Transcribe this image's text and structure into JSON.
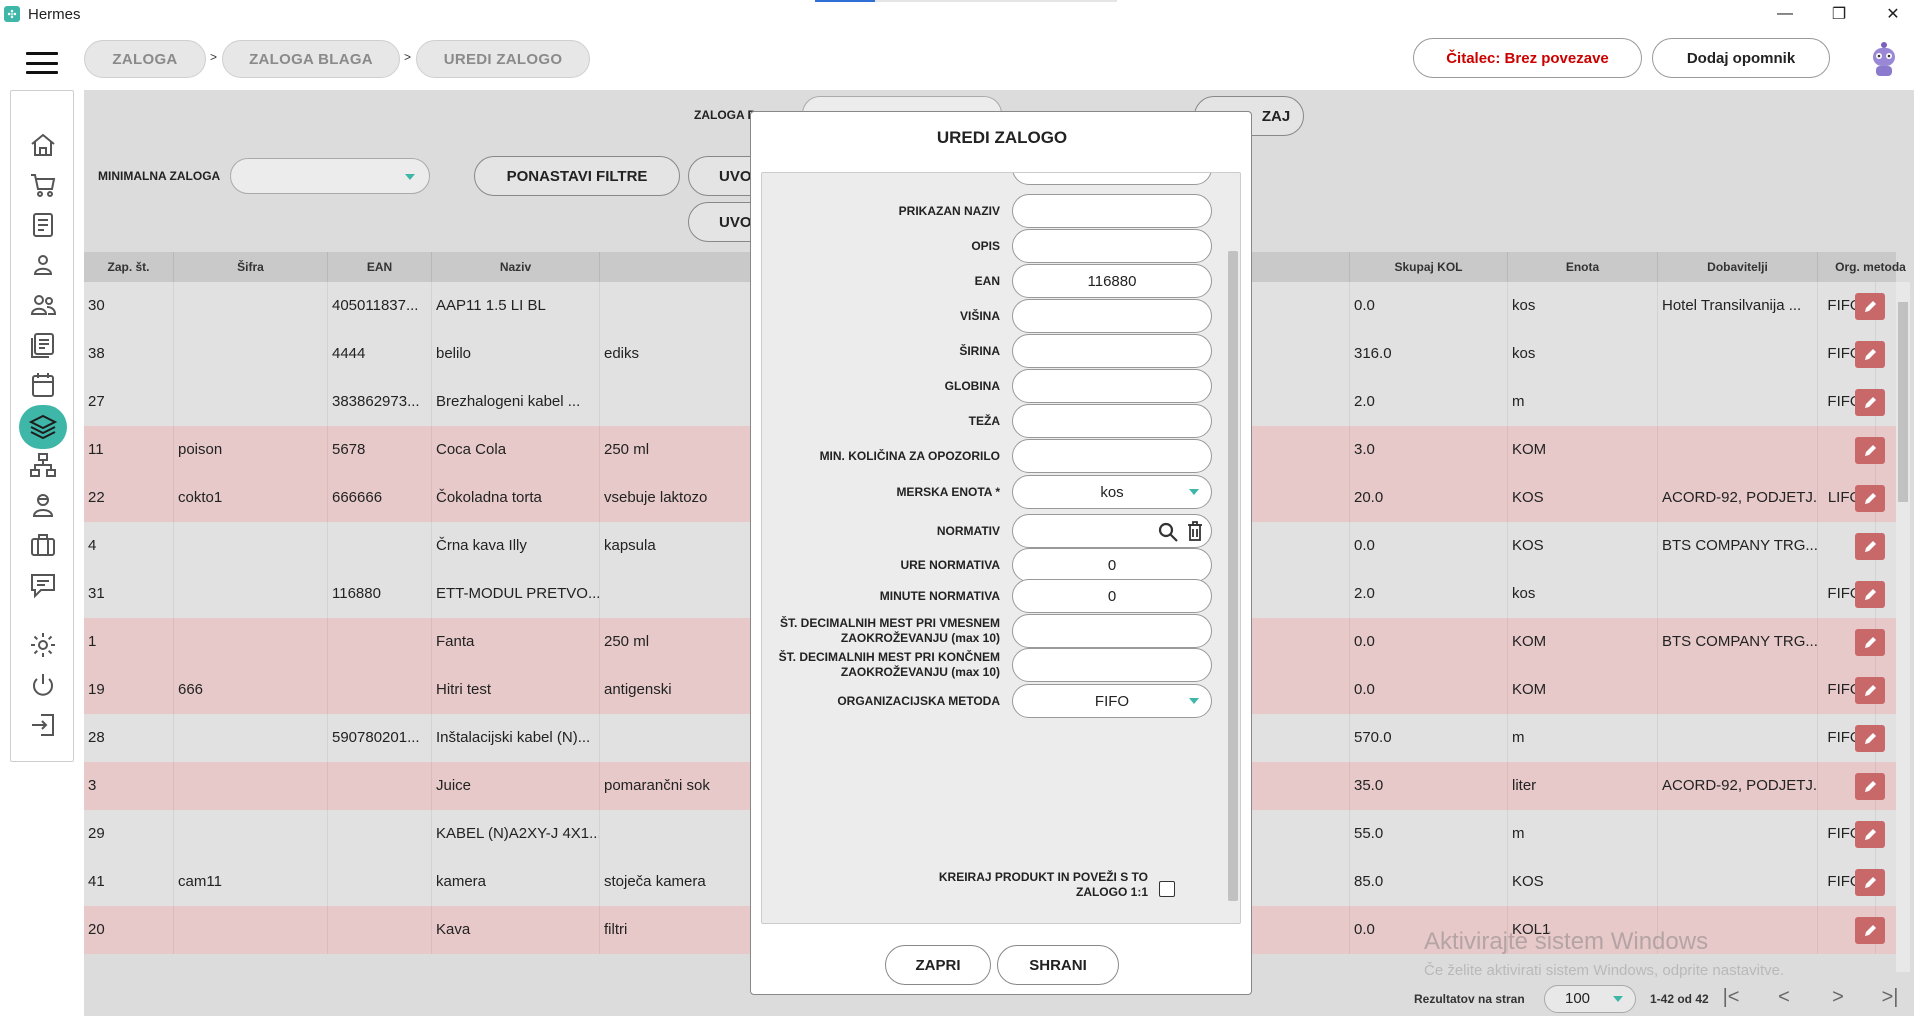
{
  "window": {
    "title": "Hermes",
    "minimize_icon": "—",
    "restore_icon": "❐",
    "close_icon": "✕"
  },
  "breadcrumb": [
    {
      "label": "ZALOGA"
    },
    {
      "label": "ZALOGA BLAGA"
    },
    {
      "label": "UREDI ZALOGO"
    }
  ],
  "breadcrumb_separator": ">",
  "header": {
    "reader_status": "Čitalec: Brez povezave",
    "reader_color": "#cc0000",
    "add_reminder": "Dodaj opomnik"
  },
  "sidebar": {
    "items": [
      "home-icon",
      "cart-icon",
      "document-icon",
      "person-icon",
      "people-icon",
      "list-icon",
      "calendar-icon",
      "layers-icon",
      "network-icon",
      "user-service-icon",
      "briefcase-icon",
      "chat-icon",
      "gear-icon",
      "power-icon",
      "logout-icon"
    ],
    "active": "layers-icon",
    "accent": "#3fb7a8"
  },
  "filters": {
    "stock_label": "ZALOGA P",
    "min_stock_label": "MINIMALNA ZALOGA",
    "reset_button": "PONASTAVI FILTRE",
    "import_button_1": "UVO",
    "import_button_2": "UVO",
    "back_button": "ZAJ"
  },
  "table": {
    "headers": {
      "index": "Zap. št.",
      "code": "Šifra",
      "ean": "EAN",
      "name": "Naziv",
      "total": "Skupaj KOL",
      "unit": "Enota",
      "suppliers": "Dobavitelji",
      "method": "Org. metoda"
    },
    "rows": [
      {
        "idx": "30",
        "code": "",
        "ean": "405011837...",
        "name": "AAP11 1.5 LI BL",
        "desc": "",
        "total": "0.0",
        "unit": "kos",
        "supplier": "Hotel Transilvanija ...",
        "method": "FIFO",
        "tint": "gray"
      },
      {
        "idx": "38",
        "code": "",
        "ean": "4444",
        "name": "belilo",
        "desc": "ediks",
        "total": "316.0",
        "unit": "kos",
        "supplier": "",
        "method": "FIFO",
        "tint": "gray"
      },
      {
        "idx": "27",
        "code": "",
        "ean": "383862973...",
        "name": "Brezhalogeni kabel ...",
        "desc": "",
        "total": "2.0",
        "unit": "m",
        "supplier": "",
        "method": "FIFO",
        "tint": "gray"
      },
      {
        "idx": "11",
        "code": "poison",
        "ean": "5678",
        "name": "Coca Cola",
        "desc": "250 ml",
        "total": "3.0",
        "unit": "KOM",
        "supplier": "",
        "method": "",
        "tint": "pink"
      },
      {
        "idx": "22",
        "code": "cokto1",
        "ean": "666666",
        "name": "Čokoladna torta",
        "desc": "vsebuje laktozo",
        "total": "20.0",
        "unit": "KOS",
        "supplier": "ACORD-92, PODJETJ...",
        "method": "LIFO",
        "tint": "pink"
      },
      {
        "idx": "4",
        "code": "",
        "ean": "",
        "name": "Črna kava Illy",
        "desc": "kapsula",
        "total": "0.0",
        "unit": "KOS",
        "supplier": "BTS COMPANY TRG...",
        "method": "",
        "tint": "gray"
      },
      {
        "idx": "31",
        "code": "",
        "ean": "116880",
        "name": "ETT-MODUL PRETVO...",
        "desc": "",
        "total": "2.0",
        "unit": "kos",
        "supplier": "",
        "method": "FIFO",
        "tint": "gray"
      },
      {
        "idx": "1",
        "code": "",
        "ean": "",
        "name": "Fanta",
        "desc": "250 ml",
        "total": "0.0",
        "unit": "KOM",
        "supplier": "BTS COMPANY TRG...",
        "method": "",
        "tint": "pink"
      },
      {
        "idx": "19",
        "code": "666",
        "ean": "",
        "name": "Hitri test",
        "desc": "antigenski",
        "total": "0.0",
        "unit": "KOM",
        "supplier": "",
        "method": "FIFO",
        "tint": "pink"
      },
      {
        "idx": "28",
        "code": "",
        "ean": "590780201...",
        "name": "Inštalacijski kabel (N)...",
        "desc": "",
        "total": "570.0",
        "unit": "m",
        "supplier": "",
        "method": "FIFO",
        "tint": "gray"
      },
      {
        "idx": "3",
        "code": "",
        "ean": "",
        "name": "Juice",
        "desc": "pomarančni sok",
        "total": "35.0",
        "unit": "liter",
        "supplier": "ACORD-92, PODJETJ...",
        "method": "",
        "tint": "pink"
      },
      {
        "idx": "29",
        "code": "",
        "ean": "",
        "name": "KABEL (N)A2XY-J 4X1...",
        "desc": "",
        "total": "55.0",
        "unit": "m",
        "supplier": "",
        "method": "FIFO",
        "tint": "gray"
      },
      {
        "idx": "41",
        "code": "cam11",
        "ean": "",
        "name": "kamera",
        "desc": "stoječa kamera",
        "total": "85.0",
        "unit": "KOS",
        "supplier": "",
        "method": "FIFO",
        "tint": "gray"
      },
      {
        "idx": "20",
        "code": "",
        "ean": "",
        "name": "Kava",
        "desc": "filtri",
        "total": "0.0",
        "unit": "KOL1",
        "supplier": "",
        "method": "",
        "tint": "pink"
      }
    ]
  },
  "footer": {
    "per_page_label": "Rezultatov na stran",
    "per_page_value": "100",
    "range": "1-42 od 42",
    "first_icon": "|<",
    "prev_icon": "<",
    "next_icon": ">",
    "last_icon": ">|"
  },
  "watermark": {
    "line1": "Aktivirajte sistem Windows",
    "line2": "Če želite aktivirati sistem Windows, odprite nastavitve."
  },
  "modal": {
    "title": "UREDI ZALOGO",
    "fields": [
      {
        "label": "PRIKAZAN NAZIV",
        "value": ""
      },
      {
        "label": "OPIS",
        "value": ""
      },
      {
        "label": "EAN",
        "value": "116880"
      },
      {
        "label": "VIŠINA",
        "value": ""
      },
      {
        "label": "ŠIRINA",
        "value": ""
      },
      {
        "label": "GLOBINA",
        "value": ""
      },
      {
        "label": "TEŽA",
        "value": ""
      },
      {
        "label": "MIN. KOLIČINA ZA OPOZORILO",
        "value": ""
      },
      {
        "label": "MERSKA ENOTA *",
        "value": "kos"
      },
      {
        "label": "NORMATIV",
        "value": ""
      },
      {
        "label": "URE NORMATIVA",
        "value": "0"
      },
      {
        "label": "MINUTE NORMATIVA",
        "value": "0"
      },
      {
        "label": "ŠT. DECIMALNIH MEST PRI VMESNEM ZAOKROŽEVANJU (max 10)",
        "value": ""
      },
      {
        "label": "ŠT. DECIMALNIH MEST PRI KONČNEM ZAOKROŽEVANJU (max 10)",
        "value": ""
      },
      {
        "label": "ORGANIZACIJSKA METODA",
        "value": "FIFO"
      }
    ],
    "checkbox_label": "KREIRAJ PRODUKT IN POVEŽI S TO ZALOGO 1:1",
    "checkbox_checked": false,
    "close_button": "ZAPRI",
    "save_button": "SHRANI"
  }
}
